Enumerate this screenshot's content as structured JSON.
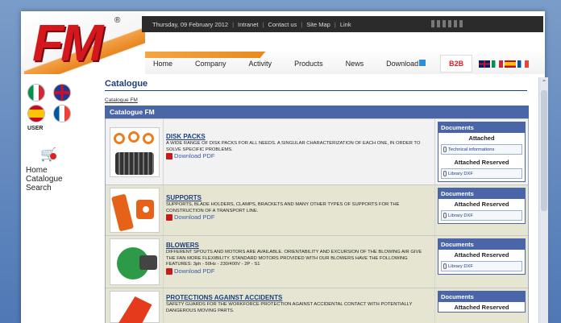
{
  "topbar": {
    "date": "Thursday, 09 February 2012",
    "links": [
      "Intranet",
      "Contact us",
      "Site Map",
      "Link"
    ]
  },
  "nav": {
    "items": [
      "Home",
      "Company",
      "Activity",
      "Products",
      "News",
      "Download"
    ],
    "b2b": "B2B"
  },
  "logo": {
    "text": "FM",
    "reg": "®"
  },
  "sidebar": {
    "user_label": "USER",
    "links": [
      "Home",
      "Catalogue",
      "Search"
    ]
  },
  "main": {
    "title": "Catalogue",
    "breadcrumb": "Catalogue FM",
    "section_header": "Catalogue FM",
    "rows": [
      {
        "name": "DISK PACKS",
        "description": "A WIDE RANGE OF DISK PACKS FOR ALL NEEDS. A SINGULAR CHARACTERIZATION OF EACH ONE, IN ORDER TO SOLVE SPECIFIC PROBLEMS.",
        "pdf": "Download PDF",
        "docs_header": "Documents",
        "docs_sub": "Attached",
        "docs_link": "Technical informations",
        "docs_sub2": "Attached Reserved",
        "docs_link2": "Library DXF"
      },
      {
        "name": "SUPPORTS",
        "description": "SUPPORTS, BLADE HOLDERS, CLAMPS, BRACKETS AND MANY OTHER TYPES OF SUPPORTS FOR THE CONSTRUCTION OF A TRANSPORT LINE.",
        "pdf": "Download PDF",
        "docs_header": "Documents",
        "docs_sub": "Attached Reserved",
        "docs_link": "Library DXF"
      },
      {
        "name": "BLOWERS",
        "description": "DIFFERENT SPOUTS AND MOTORS ARE AVAILABLE. ORIENTABILITY AND EXCURSION OF THE BLOWING AIR GIVE THE FAN MORE FLEXIBILITY. STANDARD MOTORS PROVIDED WITH OUR BLOWERS HAVE THE FOLLOWING FEATURES: 3ph - 50Hz - 230/400V - 2P - S1",
        "pdf": "Download PDF",
        "docs_header": "Documents",
        "docs_sub": "Attached Reserved",
        "docs_link": "Library DXF"
      },
      {
        "name": "PROTECTIONS AGAINST ACCIDENTS",
        "description": "SAFETY GUARDS FOR THE WORKFORCE PROTECTION AGAINST ACCIDENTAL CONTACT WITH POTENTIALLY DANGEROUS MOVING PARTS.",
        "docs_header": "Documents",
        "docs_sub": "Attached Reserved"
      }
    ]
  },
  "colors": {
    "brand_red": "#d4171c",
    "header_blue": "#4b66a8",
    "title_blue": "#1c3f7d",
    "accent_orange": "#ee7d1d"
  }
}
